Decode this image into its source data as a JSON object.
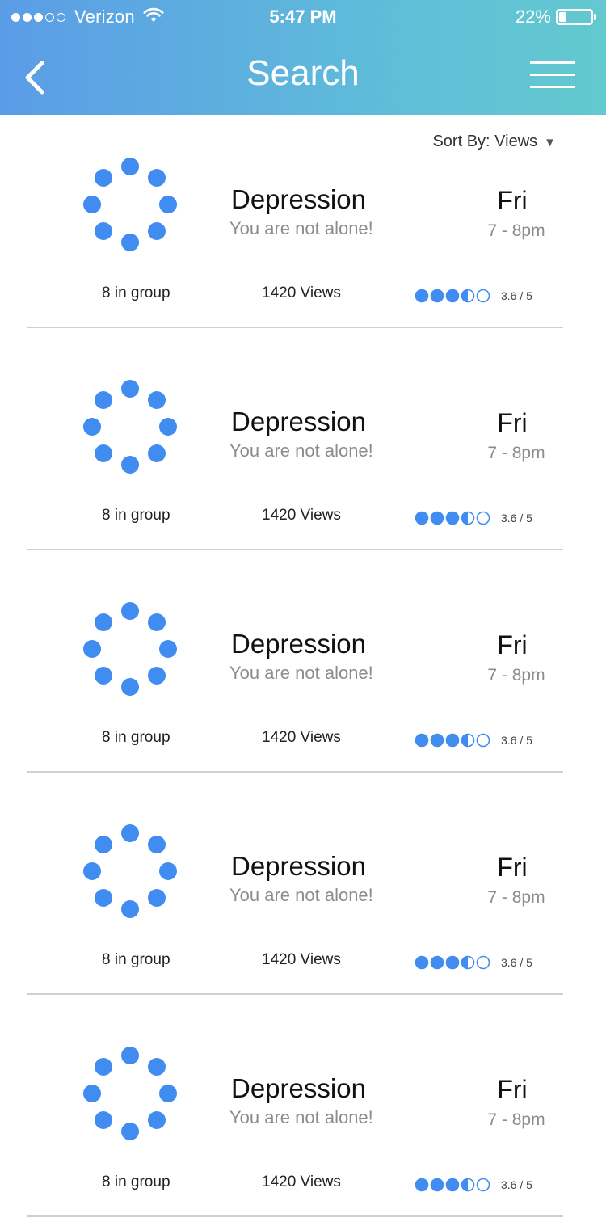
{
  "status_bar": {
    "signal_dots": [
      true,
      true,
      true,
      false,
      false
    ],
    "carrier": "Verizon",
    "time": "5:47 PM",
    "battery_percent": "22%",
    "battery_level": 0.22
  },
  "nav": {
    "title": "Search",
    "back_icon": "chevron-left-icon",
    "menu_icon": "hamburger-menu-icon"
  },
  "sort": {
    "label": "Sort By: Views",
    "caret": "▼"
  },
  "colors": {
    "accent": "#418cf0",
    "header_gradient_start": "#5b9ce6",
    "header_gradient_end": "#63c9cf"
  },
  "groups": [
    {
      "title": "Depression",
      "subtitle": "You are not alone!",
      "day": "Fri",
      "time": "7 - 8pm",
      "members": "8 in group",
      "views": "1420 Views",
      "rating_value": 3.6,
      "rating_max": 5,
      "rating_text": "3.6 / 5"
    },
    {
      "title": "Depression",
      "subtitle": "You are not alone!",
      "day": "Fri",
      "time": "7 - 8pm",
      "members": "8 in group",
      "views": "1420 Views",
      "rating_value": 3.6,
      "rating_max": 5,
      "rating_text": "3.6 / 5"
    },
    {
      "title": "Depression",
      "subtitle": "You are not alone!",
      "day": "Fri",
      "time": "7 - 8pm",
      "members": "8 in group",
      "views": "1420 Views",
      "rating_value": 3.6,
      "rating_max": 5,
      "rating_text": "3.6 / 5"
    },
    {
      "title": "Depression",
      "subtitle": "You are not alone!",
      "day": "Fri",
      "time": "7 - 8pm",
      "members": "8 in group",
      "views": "1420 Views",
      "rating_value": 3.6,
      "rating_max": 5,
      "rating_text": "3.6 / 5"
    },
    {
      "title": "Depression",
      "subtitle": "You are not alone!",
      "day": "Fri",
      "time": "7 - 8pm",
      "members": "8 in group",
      "views": "1420 Views",
      "rating_value": 3.6,
      "rating_max": 5,
      "rating_text": "3.6 / 5"
    }
  ]
}
